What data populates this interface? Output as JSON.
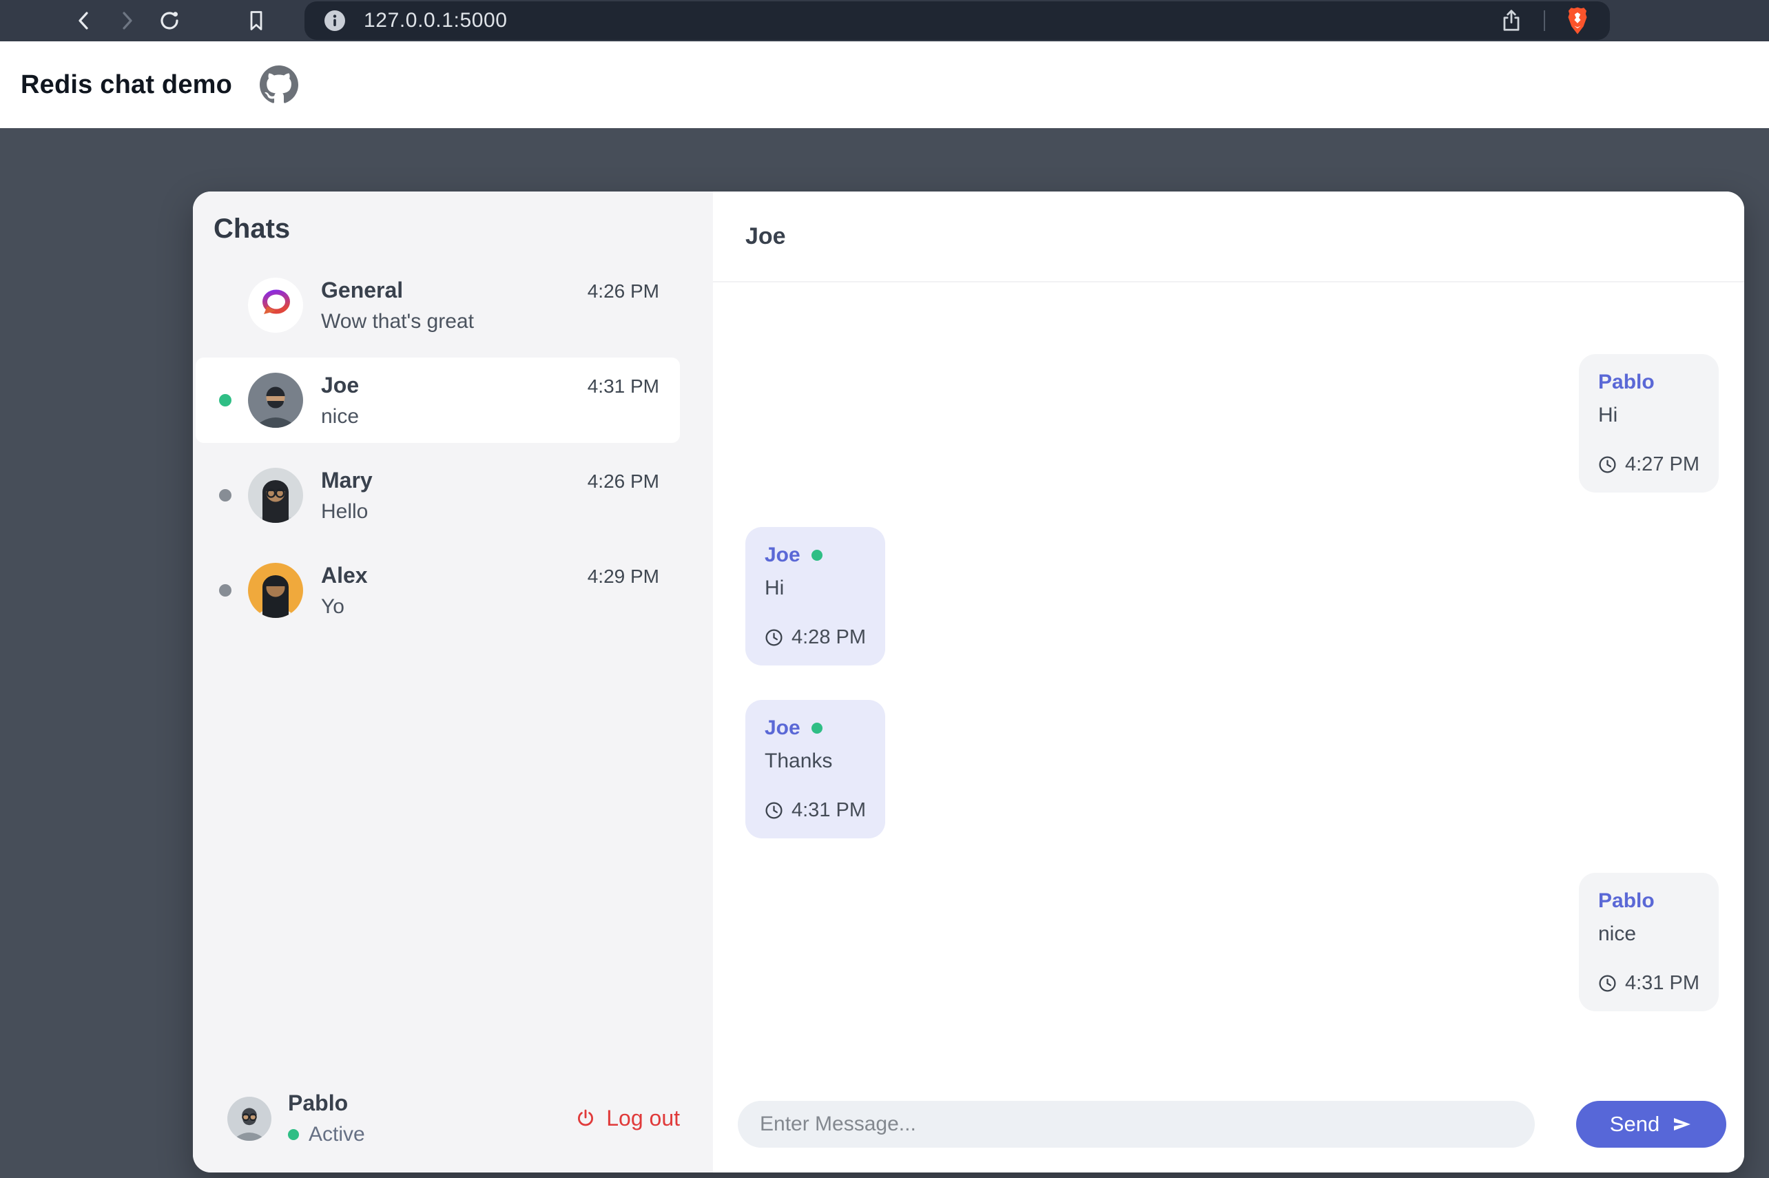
{
  "browser": {
    "url": "127.0.0.1:5000"
  },
  "header": {
    "title": "Redis chat demo"
  },
  "sidebar": {
    "title": "Chats",
    "chats": [
      {
        "name": "General",
        "preview": "Wow that's great",
        "time": "4:26 PM",
        "presence": "none",
        "selected": false,
        "avatar": "logo"
      },
      {
        "name": "Joe",
        "preview": "nice",
        "time": "4:31 PM",
        "presence": "online",
        "selected": true,
        "avatar": "man-beard"
      },
      {
        "name": "Mary",
        "preview": "Hello",
        "time": "4:26 PM",
        "presence": "offline",
        "selected": false,
        "avatar": "woman-glasses"
      },
      {
        "name": "Alex",
        "preview": "Yo",
        "time": "4:29 PM",
        "presence": "offline",
        "selected": false,
        "avatar": "woman-orange"
      }
    ],
    "user": {
      "name": "Pablo",
      "status": "Active",
      "logout": "Log out",
      "avatar": "man-glasses"
    }
  },
  "chat": {
    "title": "Joe",
    "messages": [
      {
        "sender": "Pablo",
        "text": "Hi",
        "time": "4:27 PM",
        "side": "right",
        "online": false
      },
      {
        "sender": "Joe",
        "text": "Hi",
        "time": "4:28 PM",
        "side": "left",
        "online": true
      },
      {
        "sender": "Joe",
        "text": "Thanks",
        "time": "4:31 PM",
        "side": "left",
        "online": true
      },
      {
        "sender": "Pablo",
        "text": "nice",
        "time": "4:31 PM",
        "side": "right",
        "online": false
      }
    ],
    "composer": {
      "placeholder": "Enter Message...",
      "send": "Send"
    }
  },
  "colors": {
    "accent_indigo": "#5767d8",
    "online_green": "#2fbe85",
    "logout_red": "#e03a3a",
    "toolbar": "#343b48",
    "url_pill": "#1f2632",
    "page_bg": "#474e59",
    "sidebar_bg": "#f4f4f6",
    "bubble_left": "#e8eafa",
    "bubble_right": "#f3f4f6",
    "brave_orange": "#fb542b"
  }
}
